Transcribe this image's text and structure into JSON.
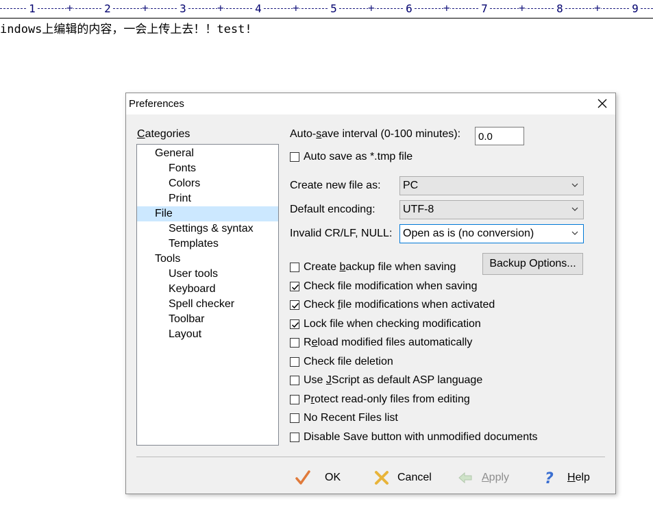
{
  "editor": {
    "ruler_numbers": [
      "1",
      "2",
      "3",
      "4",
      "5",
      "6",
      "7",
      "8",
      "9"
    ],
    "line1": "indows上编辑的内容，一会上传上去！！test!"
  },
  "dialog": {
    "title": "Preferences",
    "categories_label_u": "C",
    "categories_label_rest": "ategories",
    "tree": [
      {
        "label": "General",
        "level": 0
      },
      {
        "label": "Fonts",
        "level": 1
      },
      {
        "label": "Colors",
        "level": 1
      },
      {
        "label": "Print",
        "level": 1
      },
      {
        "label": "File",
        "level": 0,
        "selected": true
      },
      {
        "label": "Settings & syntax",
        "level": 1
      },
      {
        "label": "Templates",
        "level": 1
      },
      {
        "label": "Tools",
        "level": 0
      },
      {
        "label": "User tools",
        "level": 1
      },
      {
        "label": "Keyboard",
        "level": 1
      },
      {
        "label": "Spell checker",
        "level": 1
      },
      {
        "label": "Toolbar",
        "level": 1
      },
      {
        "label": "Layout",
        "level": 1
      }
    ],
    "autosave": {
      "label_a": "Auto-",
      "label_u": "s",
      "label_b": "ave interval (0-100 minutes):",
      "value": "0.0"
    },
    "tmp_checkbox": {
      "label": "Auto save as *.tmp file",
      "checked": false
    },
    "new_file": {
      "label": "Create new file as:",
      "value": "PC"
    },
    "encoding": {
      "label": "Default encoding:",
      "value": "UTF-8"
    },
    "crlf": {
      "label": "Invalid CR/LF, NULL:",
      "value": "Open as is (no conversion)"
    },
    "backup_options_label": "Backup Options...",
    "checkboxes": [
      {
        "pre": "Create ",
        "u": "b",
        "post": "ackup file when saving",
        "checked": false
      },
      {
        "pre": "Check file modification when saving",
        "u": "",
        "post": "",
        "checked": true
      },
      {
        "pre": "Check ",
        "u": "f",
        "post": "ile modifications when activated",
        "checked": true
      },
      {
        "pre": "Lock file when checking modification",
        "u": "",
        "post": "",
        "checked": true
      },
      {
        "pre": "R",
        "u": "e",
        "post": "load modified files automatically",
        "checked": false
      },
      {
        "pre": "Check file deletion",
        "u": "",
        "post": "",
        "checked": false
      },
      {
        "pre": "Use ",
        "u": "J",
        "post": "Script as default ASP language",
        "checked": false
      },
      {
        "pre": "P",
        "u": "r",
        "post": "otect read-only files from editing",
        "checked": false
      },
      {
        "pre": "No Recent Files list",
        "u": "",
        "post": "",
        "checked": false
      },
      {
        "pre": "Disable Save button with unmodified documents",
        "u": "",
        "post": "",
        "checked": false
      }
    ],
    "footer": {
      "ok": "OK",
      "cancel": "Cancel",
      "apply_u": "A",
      "apply_rest": "pply",
      "help_u": "H",
      "help_rest": "elp"
    }
  },
  "colors": {
    "selection": "#cce8ff",
    "focus_border": "#0078d7",
    "ruler_text": "#00006e"
  }
}
